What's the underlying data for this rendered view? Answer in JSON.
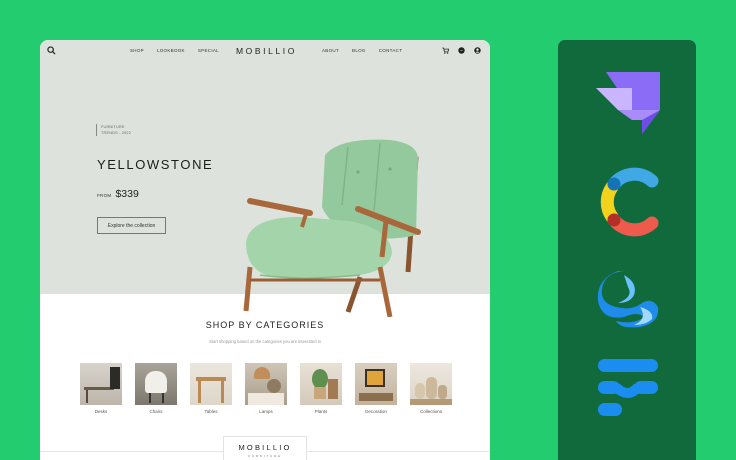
{
  "nav": {
    "left_links": [
      "SHOP",
      "LOOKBOOK",
      "SPECIAL"
    ],
    "logo": "MOBILLIO",
    "right_links": [
      "ABOUT",
      "BLOG",
      "CONTACT"
    ],
    "icons": [
      "search-icon",
      "cart-icon",
      "messenger-icon",
      "user-icon"
    ]
  },
  "hero": {
    "tag_line1": "FURNITURE",
    "tag_line2": "TRENDS - 2022",
    "title": "YELLOWSTONE",
    "from_label": "FROM",
    "price": "$339",
    "cta": "Explore the collection",
    "colors": {
      "background": "#dde3dc",
      "chair": "#9fd2a6",
      "wood": "#a9683c"
    }
  },
  "categories": {
    "title": "SHOP BY CATEGORIES",
    "subtitle": "Start shopping based on the categories you are interested in",
    "items": [
      {
        "label": "Desks"
      },
      {
        "label": "Chairs"
      },
      {
        "label": "Tables"
      },
      {
        "label": "Lamps"
      },
      {
        "label": "Plants"
      },
      {
        "label": "Decoration"
      },
      {
        "label": "Collections"
      }
    ]
  },
  "footer": {
    "logo": "MOBILLIO",
    "sub": "FURNITURE"
  },
  "panel": {
    "background": "#116a3c",
    "logos": [
      "stackbit-logo",
      "contentful-logo",
      "sanity-cms-logo",
      "framer-logo"
    ]
  }
}
